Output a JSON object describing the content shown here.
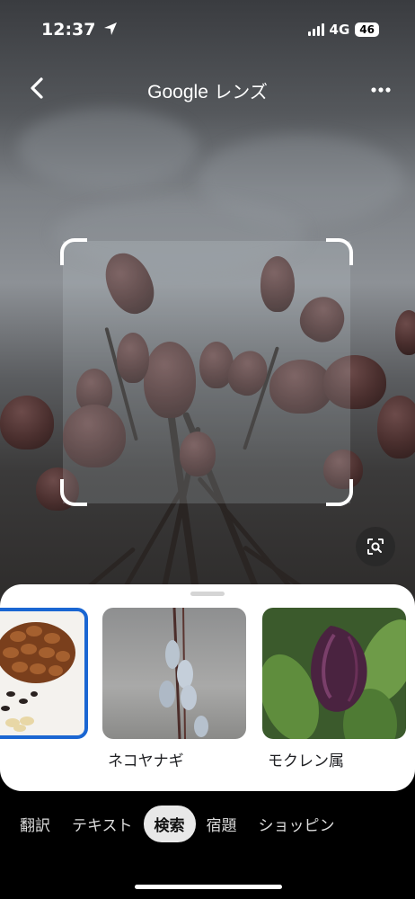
{
  "status_bar": {
    "time": "12:37",
    "network": "4G",
    "battery": "46",
    "location_icon": "location-arrow-icon",
    "signal_icon": "signal-bars-icon"
  },
  "header": {
    "title_brand": "Google",
    "title_suffix": "レンズ",
    "back_icon": "chevron-left-icon",
    "more_icon": "more-dots-icon"
  },
  "selection": {
    "search_region_icon": "lens-search-icon"
  },
  "results": [
    {
      "label": "",
      "selected": true
    },
    {
      "label": "ネコヤナギ",
      "selected": false
    },
    {
      "label": "モクレン属",
      "selected": false
    }
  ],
  "tabs": [
    {
      "label": "翻訳",
      "active": false
    },
    {
      "label": "テキスト",
      "active": false
    },
    {
      "label": "検索",
      "active": true
    },
    {
      "label": "宿題",
      "active": false
    },
    {
      "label": "ショッピン",
      "active": false
    }
  ],
  "colors": {
    "accent": "#1a66d2",
    "sheet_bg": "#ffffff",
    "active_tab_bg": "#e8e8e8"
  }
}
